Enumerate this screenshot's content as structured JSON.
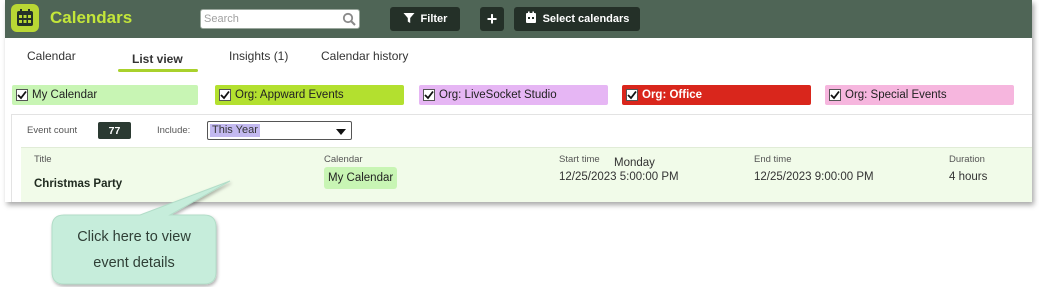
{
  "header": {
    "title": "Calendars",
    "search_placeholder": "Search",
    "filter_label": "Filter",
    "add_label": "+",
    "select_calendars_label": "Select calendars"
  },
  "icons": {
    "app": "calendar-icon",
    "search": "search-icon",
    "filter": "funnel-icon",
    "select_calendars": "calendar-badge-icon",
    "checkbox": "checkmark-icon",
    "dropdown": "chevron-down-icon"
  },
  "tabs": [
    {
      "label": "Calendar",
      "active": false
    },
    {
      "label": "List view",
      "active": true
    },
    {
      "label": "Insights (1)",
      "active": false
    },
    {
      "label": "Calendar history",
      "active": false
    }
  ],
  "calendars": [
    {
      "label": "My Calendar",
      "checked": true,
      "color": "#c8f5b4"
    },
    {
      "label": "Org: Appward Events",
      "checked": true,
      "color": "#b3e02f"
    },
    {
      "label": "Org: LiveSocket Studio",
      "checked": true,
      "color": "#e6b6f4"
    },
    {
      "label": "Org: Office",
      "checked": true,
      "color": "#d9261c"
    },
    {
      "label": "Org: Special Events",
      "checked": true,
      "color": "#f6b6de"
    }
  ],
  "list": {
    "event_count_label": "Event count",
    "event_count": "77",
    "include_label": "Include:",
    "include_value": "This Year",
    "columns": {
      "title": "Title",
      "calendar": "Calendar",
      "start": "Start time",
      "end": "End time",
      "duration": "Duration"
    },
    "events": [
      {
        "title": "Christmas Party",
        "calendar": "My Calendar",
        "start_day": "Monday",
        "start": "12/25/2023 5:00:00 PM",
        "end": "12/25/2023 9:00:00 PM",
        "duration": "4 hours"
      }
    ]
  },
  "callout": {
    "text_line1": "Click here to view",
    "text_line2": "event details"
  },
  "colors": {
    "header_bg": "#4f6556",
    "accent_green": "#b9d734",
    "button_dark": "#243028",
    "row_highlight": "#f1fbe9",
    "callout_bg": "#c6eddb"
  }
}
